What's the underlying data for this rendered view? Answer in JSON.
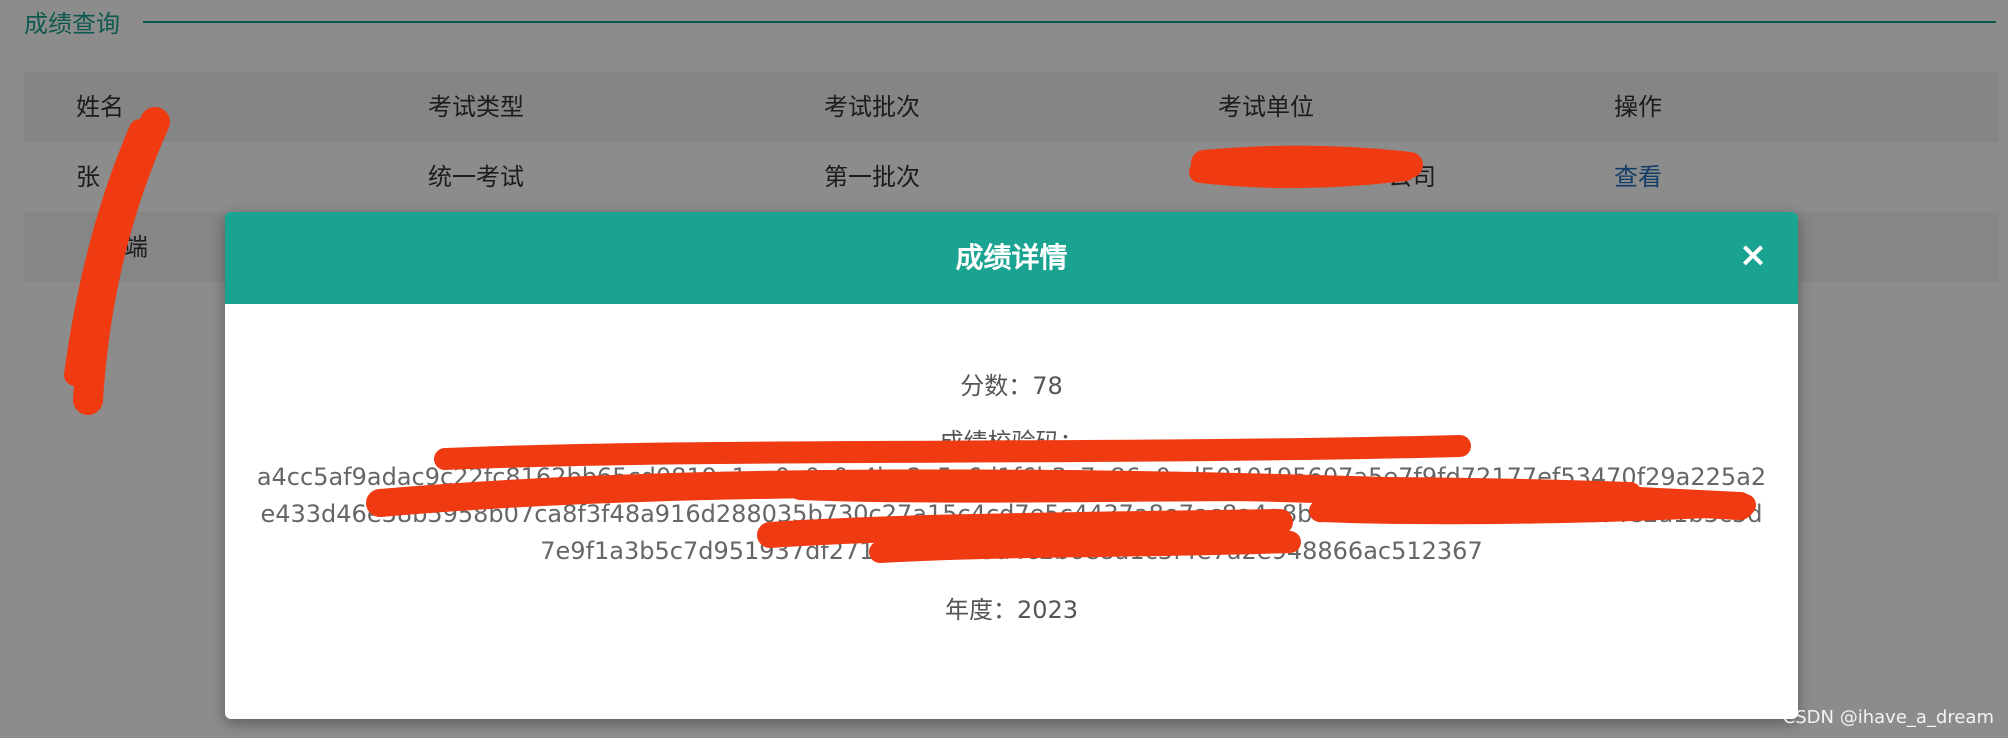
{
  "page": {
    "section_title": "成绩查询",
    "table": {
      "headers": [
        "姓名",
        "考试类型",
        "考试批次",
        "考试单位",
        "操作"
      ],
      "rows": [
        {
          "name": "张",
          "type": "统一考试",
          "batch": "第一批次",
          "unit": "公司",
          "action": "查看"
        },
        {
          "name": "端",
          "type": "",
          "batch": "",
          "unit": "",
          "action": ""
        }
      ]
    }
  },
  "modal": {
    "title": "成绩详情",
    "close_icon": "×",
    "score_text": "分数：78",
    "code_label": "成绩校验码：",
    "code_value": "a4cc5af9adac9c22fc8162bb65cd0819a1ca0a0c0c4ba2a5a6d1f6b3c7e86e0ad5010195607a5e7f9fd72177ef53470f29a225a2e433d46e38b5958b07ca8f3f48a916d288035b730c27a15c4cd7e5c4437a8e7ac8a4a8b6f2e0b6a9c8d7e5f3e7c64e2a1b3c5d7e9f1a3b5c7d951937df2718de88ed5a4c2b6e8a1c3f4e7a2e948866ac512367",
    "year_text": "年度：2023"
  },
  "watermark": "CSDN @ihave_a_dream",
  "colors": {
    "accent": "#1ba391",
    "link": "#1f6fbf",
    "redaction": "#f03a12"
  }
}
